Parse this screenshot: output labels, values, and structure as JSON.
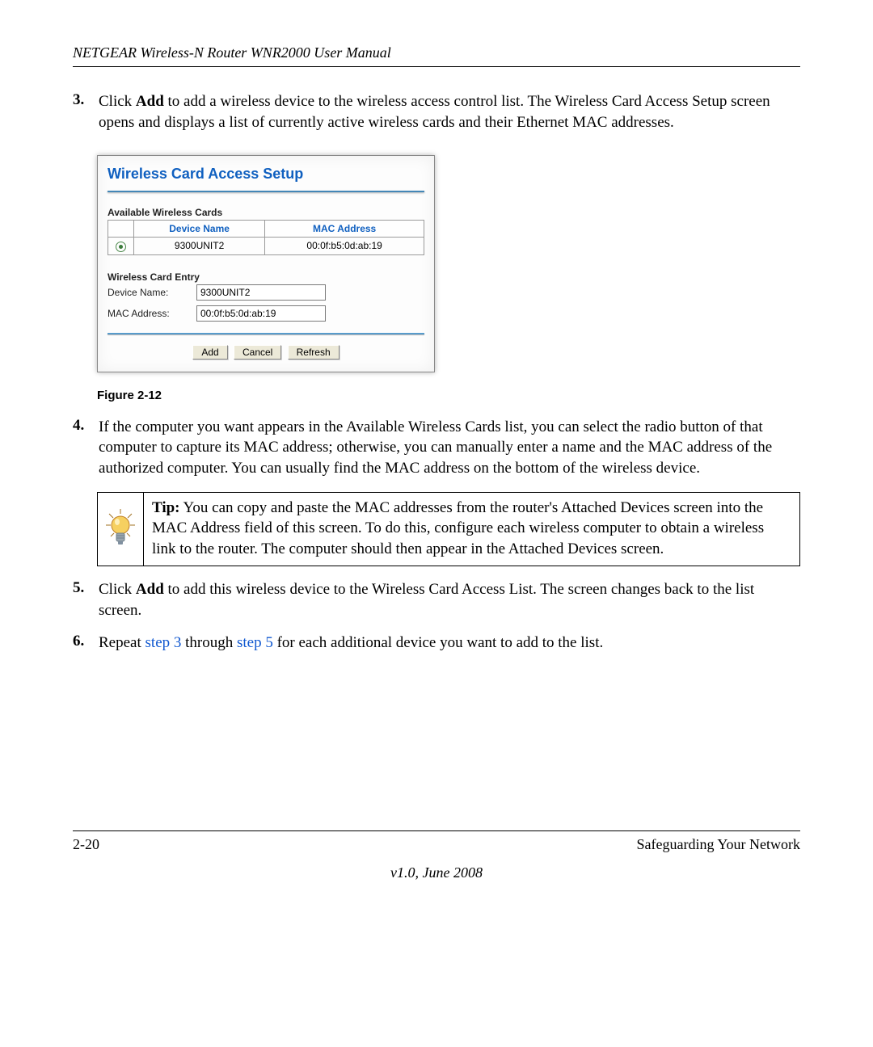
{
  "header": "NETGEAR Wireless-N Router WNR2000 User Manual",
  "steps": {
    "s3_num": "3.",
    "s3_pre": "Click ",
    "s3_bold": "Add",
    "s3_post": " to add a wireless device to the wireless access control list. The Wireless Card Access Setup screen opens and displays a list of currently active wireless cards and their Ethernet MAC addresses.",
    "s4_num": "4.",
    "s4_text": "If the computer you want appears in the Available Wireless Cards list, you can select the radio button of that computer to capture its MAC address; otherwise, you can manually enter a name and the MAC address of the authorized computer. You can usually find the MAC address on the bottom of the wireless device.",
    "s5_num": "5.",
    "s5_pre": "Click ",
    "s5_bold": "Add",
    "s5_post": " to add this wireless device to the Wireless Card Access List. The screen changes back to the list screen.",
    "s6_num": "6.",
    "s6_a": "Repeat ",
    "s6_link1": "step 3",
    "s6_b": " through ",
    "s6_link2": "step 5",
    "s6_c": " for each additional device you want to add to the list."
  },
  "figure_caption": "Figure 2-12",
  "panel": {
    "title": "Wireless Card Access Setup",
    "available_heading": "Available Wireless Cards",
    "col_device": "Device Name",
    "col_mac": "MAC Address",
    "row_device": "9300UNIT2",
    "row_mac": "00:0f:b5:0d:ab:19",
    "entry_heading": "Wireless Card Entry",
    "lbl_device": "Device Name:",
    "lbl_mac": "MAC Address:",
    "input_device": "9300UNIT2",
    "input_mac": "00:0f:b5:0d:ab:19",
    "btn_add": "Add",
    "btn_cancel": "Cancel",
    "btn_refresh": "Refresh"
  },
  "tip": {
    "label": "Tip:",
    "text": " You can copy and paste the MAC addresses from the router's Attached Devices screen into the MAC Address field of this screen. To do this, configure each wireless computer to obtain a wireless link to the router. The computer should then appear in the Attached Devices screen."
  },
  "footer": {
    "left": "2-20",
    "right": "Safeguarding Your Network",
    "version": "v1.0, June 2008"
  }
}
